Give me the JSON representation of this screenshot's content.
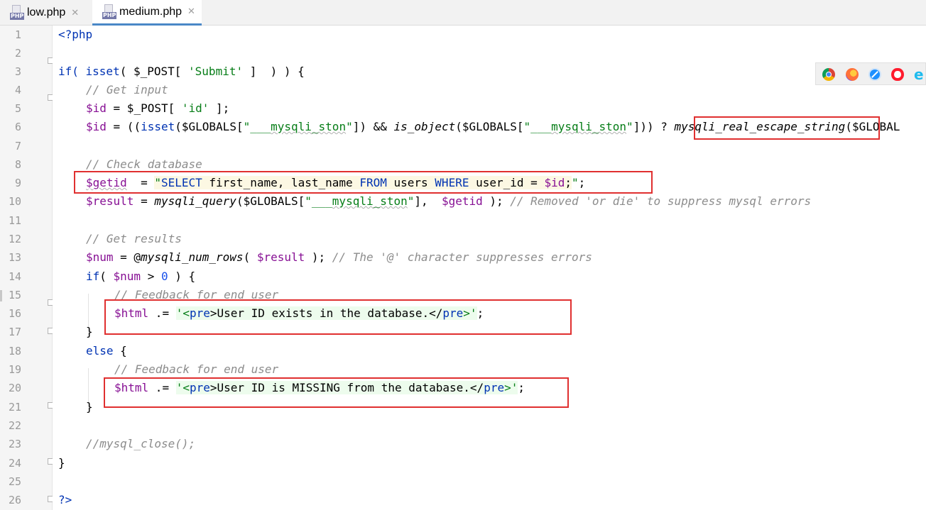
{
  "tabs": [
    {
      "label": "low.php",
      "icon": "php-file-icon",
      "active": false
    },
    {
      "label": "medium.php",
      "icon": "php-file-icon",
      "active": true
    }
  ],
  "tab_icon_text": "PHP",
  "close_glyph": "✕",
  "line_numbers": [
    "1",
    "2",
    "3",
    "4",
    "5",
    "6",
    "7",
    "8",
    "9",
    "10",
    "11",
    "12",
    "13",
    "14",
    "15",
    "16",
    "17",
    "18",
    "19",
    "20",
    "21",
    "22",
    "23",
    "24",
    "25",
    "26"
  ],
  "code": {
    "l1": "<?php",
    "l3": {
      "a": "if( ",
      "b": "isset",
      "c": "( $_POST[ ",
      "d": "'Submit'",
      "e": " ]  ) ) {"
    },
    "l4": "// Get input",
    "l5": {
      "a": "$id",
      "b": " = $_POST[ ",
      "c": "'id'",
      "d": " ];"
    },
    "l6": {
      "a": "$id",
      "b": " = ((",
      "c": "isset",
      "d": "($GLOBALS[",
      "e": "\"___",
      "f": "mysqli_ston",
      "g": "\"",
      "h": "]) && ",
      "i": "is_object",
      "j": "($GLOBALS[",
      "k": "\"___",
      "l": "mysqli_ston",
      "m": "\"",
      "n": "])) ? ",
      "o": "mysqli_real_escape_string",
      "p": "($GLOBAL"
    },
    "l8": "// Check database",
    "l9": {
      "a": "$getid",
      "b": "  = ",
      "c": "\"",
      "d": "SELECT",
      "e": " first_name, last_name ",
      "f": "FROM",
      "g": " users ",
      "h": "WHERE",
      "i": " user_id = ",
      "j": "$id",
      "k": ";",
      "l": "\"",
      "m": ";"
    },
    "l10": {
      "a": "$result",
      "b": " = ",
      "c": "mysqli_query",
      "d": "($GLOBALS[",
      "e": "\"___",
      "f": "mysqli_ston",
      "g": "\"",
      "h": "],  ",
      "i": "$getid",
      "j": " ); ",
      "k": "// Removed 'or die' to suppress mysql errors"
    },
    "l12": "// Get results",
    "l13": {
      "a": "$num",
      "b": " = @",
      "c": "mysqli_num_rows",
      "d": "( ",
      "e": "$result",
      "f": " ); ",
      "g": "// The '@' character suppresses errors"
    },
    "l14": {
      "a": "if",
      "b": "( ",
      "c": "$num",
      "d": " > ",
      "e": "0",
      "f": " ) {"
    },
    "l15": "// Feedback for end user",
    "l16": {
      "a": "$html",
      "b": " .= ",
      "c": "'<",
      "d": "pre",
      "e": ">User ID exists in the database.</",
      "f": "pre",
      "g": ">'",
      "h": ";"
    },
    "l17": "}",
    "l18": {
      "a": "else",
      "b": " {"
    },
    "l19": "// Feedback for end user",
    "l20": {
      "a": "$html",
      "b": " .= ",
      "c": "'<",
      "d": "pre",
      "e": ">User ID is MISSING from the database.</",
      "f": "pre",
      "g": ">'",
      "h": ";"
    },
    "l21": "}",
    "l23": "//mysql_close();",
    "l24": "}",
    "l26": "?>"
  },
  "browser_icons": [
    {
      "name": "chrome-icon",
      "color": "#db4437"
    },
    {
      "name": "firefox-icon",
      "color": "#ff7139"
    },
    {
      "name": "safari-icon",
      "color": "#1e90ff"
    },
    {
      "name": "opera-icon",
      "color": "#ff1b2d"
    },
    {
      "name": "ie-icon",
      "color": "#1ebbee"
    }
  ],
  "colors": {
    "highlight_box": "#e03030",
    "keyword": "#0033b3",
    "string": "#067d17",
    "comment": "#8c8c8c",
    "variable": "#871094",
    "active_tab_underline": "#4a88c7"
  }
}
